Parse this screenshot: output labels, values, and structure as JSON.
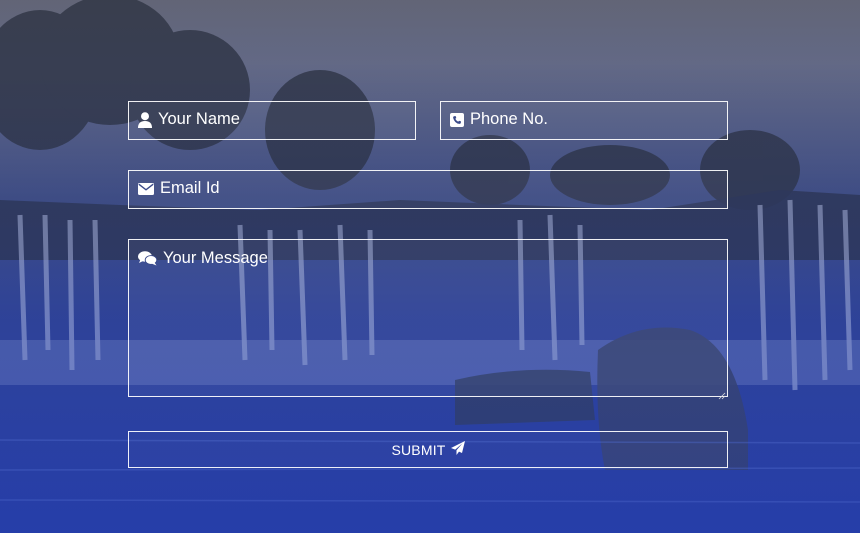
{
  "form": {
    "name": {
      "placeholder": "Your Name",
      "value": "",
      "icon": "user-icon"
    },
    "phone": {
      "placeholder": "Phone No.",
      "value": "",
      "icon": "phone-icon"
    },
    "email": {
      "placeholder": "Email Id",
      "value": "",
      "icon": "envelope-icon"
    },
    "message": {
      "placeholder": "Your Message",
      "value": "",
      "icon": "comments-icon"
    },
    "submit": {
      "label": "SUBMIT",
      "icon": "paper-plane-icon"
    }
  },
  "colors": {
    "border": "#ffffff",
    "text": "#ffffff",
    "overlay_top": "#6b6f80",
    "overlay_bottom": "#2a41a8"
  }
}
